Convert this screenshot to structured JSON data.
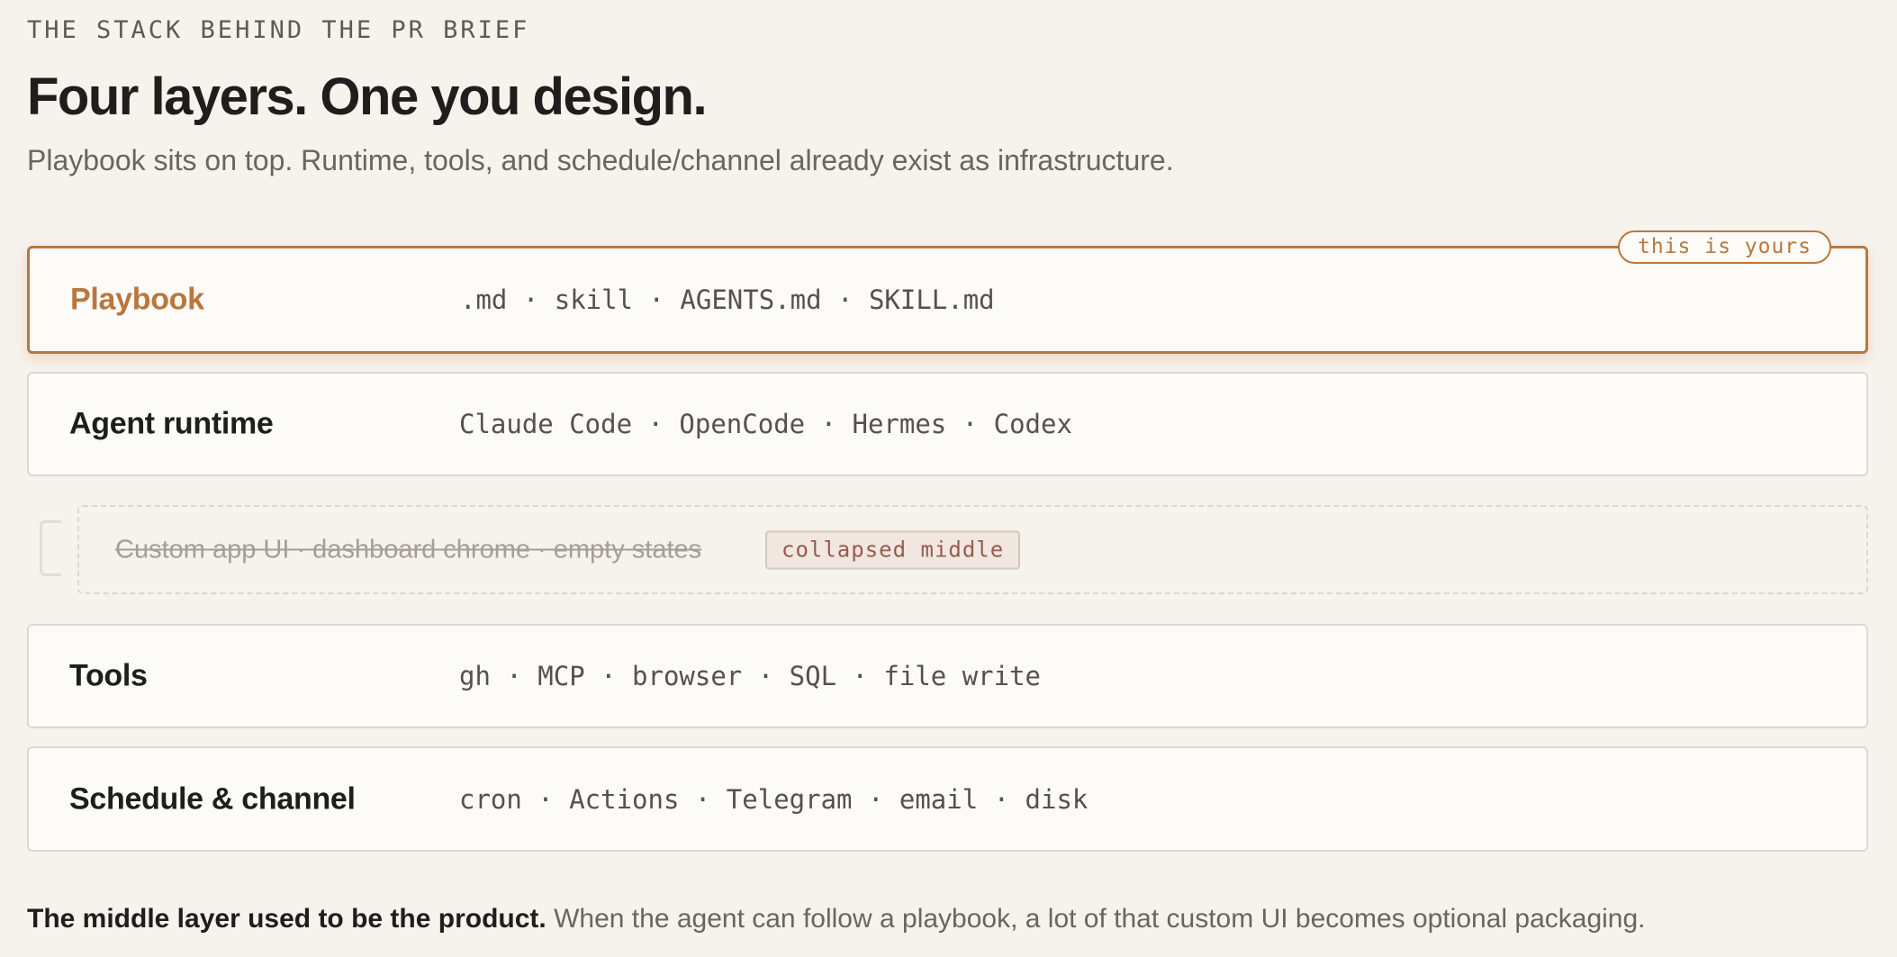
{
  "header": {
    "eyebrow": "THE STACK BEHIND THE PR BRIEF",
    "title": "Four layers. One you design.",
    "subtitle": "Playbook sits on top. Runtime, tools, and schedule/channel already exist as infrastructure."
  },
  "layers": [
    {
      "name": "Playbook",
      "items": ".md · skill · AGENTS.md · SKILL.md",
      "tag": "this is yours"
    },
    {
      "name": "Agent runtime",
      "items": "Claude Code · OpenCode · Hermes · Codex"
    },
    {
      "name": "Tools",
      "items": "gh · MCP · browser · SQL · file write"
    },
    {
      "name": "Schedule & channel",
      "items": "cron · Actions · Telegram · email · disk"
    }
  ],
  "collapsed": {
    "text": "Custom app UI · dashboard chrome · empty states",
    "tag": "collapsed middle"
  },
  "footer": {
    "bold": "The middle layer used to be the product.",
    "rest": " When the agent can follow a playbook, a lot of that custom UI becomes optional packaging."
  },
  "colors": {
    "accent": "#b9773e",
    "background": "#f6f2ec",
    "card": "#fcfbf8",
    "collapsed_tag": "#9a5a4c"
  }
}
